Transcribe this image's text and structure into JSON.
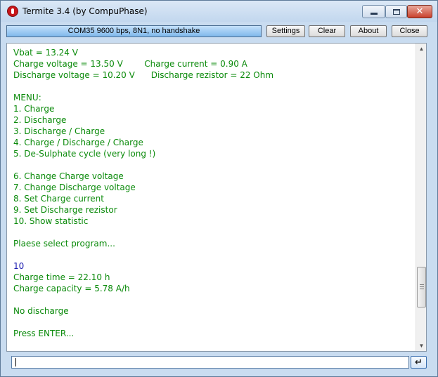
{
  "window": {
    "title": "Termite 3.4 (by CompuPhase)"
  },
  "toolbar": {
    "status": "COM35 9600 bps, 8N1, no handshake",
    "settings_label": "Settings",
    "clear_label": "Clear",
    "about_label": "About",
    "close_label": "Close"
  },
  "terminal": {
    "lines": [
      {
        "text": "Vbat = 13.24 V",
        "kind": "device"
      },
      {
        "text": "Charge voltage = 13.50 V        Charge current = 0.90 A",
        "kind": "device"
      },
      {
        "text": "Discharge voltage = 10.20 V      Discharge rezistor = 22 Ohm",
        "kind": "device"
      },
      {
        "text": "",
        "kind": "device"
      },
      {
        "text": "MENU:",
        "kind": "device"
      },
      {
        "text": "1. Charge",
        "kind": "device"
      },
      {
        "text": "2. Discharge",
        "kind": "device"
      },
      {
        "text": "3. Discharge / Charge",
        "kind": "device"
      },
      {
        "text": "4. Charge / Discharge / Charge",
        "kind": "device"
      },
      {
        "text": "5. De-Sulphate cycle (very long !)",
        "kind": "device"
      },
      {
        "text": "",
        "kind": "device"
      },
      {
        "text": "6. Change Charge voltage",
        "kind": "device"
      },
      {
        "text": "7. Change Discharge voltage",
        "kind": "device"
      },
      {
        "text": "8. Set Charge current",
        "kind": "device"
      },
      {
        "text": "9. Set Discharge rezistor",
        "kind": "device"
      },
      {
        "text": "10. Show statistic",
        "kind": "device"
      },
      {
        "text": "",
        "kind": "device"
      },
      {
        "text": "Plaese select program...",
        "kind": "device"
      },
      {
        "text": "",
        "kind": "device"
      },
      {
        "text": "10",
        "kind": "user"
      },
      {
        "text": "Charge time = 22.10 h",
        "kind": "device"
      },
      {
        "text": "Charge capacity = 5.78 A/h",
        "kind": "device"
      },
      {
        "text": "",
        "kind": "device"
      },
      {
        "text": "No discharge",
        "kind": "device"
      },
      {
        "text": "",
        "kind": "device"
      },
      {
        "text": "Press ENTER...",
        "kind": "device"
      }
    ],
    "colors": {
      "device_text": "#0a8a0a",
      "user_text": "#1a1ab0"
    }
  },
  "input": {
    "value": ""
  },
  "icons": {
    "app": "termite-app-icon",
    "send": "enter-return-icon"
  }
}
